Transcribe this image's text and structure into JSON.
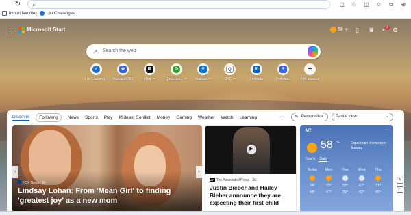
{
  "browser": {
    "url_placeholder": "",
    "favorites": [
      {
        "label": "Import favorites"
      },
      {
        "label": "List Challenges"
      }
    ]
  },
  "header": {
    "brand": "Microsoft Start",
    "weather_temp": "58",
    "weather_unit": "°F",
    "notification_count": "2"
  },
  "search": {
    "placeholder": "Search the web"
  },
  "shortcuts": [
    {
      "label": "List Challeng...",
      "icon": "check-icon",
      "color": "#1f6fd1"
    },
    {
      "label": "Microsoft 365",
      "icon": "m365-icon",
      "color": "#3b62d9"
    },
    {
      "label": "eBay ᴬᵈ",
      "icon": "ebay-icon",
      "color": "#111111"
    },
    {
      "label": "QuickBoo... ᴬᵈ",
      "icon": "quickbooks-icon",
      "color": "#2ca01c"
    },
    {
      "label": "Walmart ᴬᵈ",
      "icon": "walmart-icon",
      "color": "#0071ce"
    },
    {
      "label": "QVC ᴬᵈ",
      "icon": "qvc-icon",
      "color": "#555555"
    },
    {
      "label": "LinkedIn",
      "icon": "linkedin-icon",
      "color": "#0a66c2"
    },
    {
      "label": "Following",
      "icon": "following-icon",
      "color": "#3b62d9"
    },
    {
      "label": "Add shortcut",
      "icon": "plus-icon",
      "color": "#333333"
    }
  ],
  "feed": {
    "tabs": [
      "Discover",
      "Following",
      "News",
      "Sports",
      "Play",
      "Mideast Conflict",
      "Money",
      "Gaming",
      "Weather",
      "Watch",
      "Learning"
    ],
    "more": "···",
    "personalize": "Personalize",
    "view": "Partial view"
  },
  "cards": {
    "main": {
      "source": "FOX News · 5h",
      "headline": "Lindsay Lohan: From 'Mean Girl' to finding 'greatest joy' as a new mom"
    },
    "second": {
      "source": "The Associated Press · 2d",
      "headline": "Justin Bieber and Hailey Bieber announce they are expecting their first child"
    }
  },
  "weather": {
    "location": "MT",
    "temp": "58",
    "unit": "°F",
    "note": "Expect rain showers on Sunday",
    "tabs": [
      "Hourly",
      "Daily"
    ],
    "days": [
      {
        "name": "Today",
        "hi": "74°",
        "lo": "44°",
        "icon": "sun"
      },
      {
        "name": "Mon",
        "hi": "75°",
        "lo": "47°",
        "icon": "sun"
      },
      {
        "name": "Tue",
        "hi": "58°",
        "lo": "39°",
        "icon": "cloud"
      },
      {
        "name": "Wed",
        "hi": "62°",
        "lo": "42°",
        "icon": "cloud"
      },
      {
        "name": "Thu",
        "hi": "71°",
        "lo": "45°",
        "icon": "sun"
      }
    ]
  }
}
